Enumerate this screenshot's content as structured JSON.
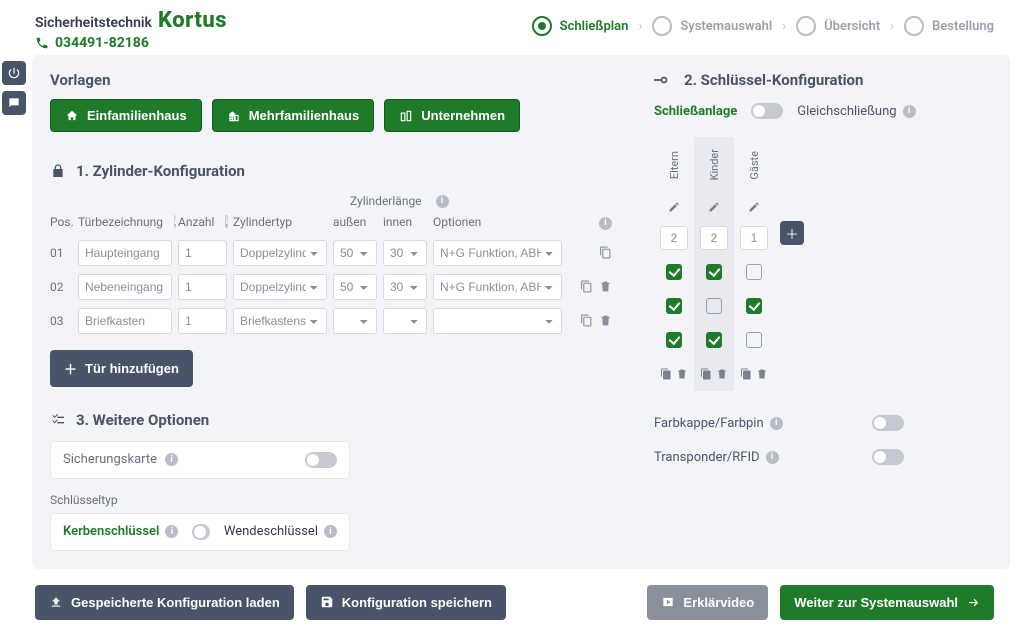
{
  "brand": {
    "sub": "Sicherheitstechnik",
    "main": "Kortus",
    "phone": "034491-82186"
  },
  "steps": [
    {
      "label": "Schließplan",
      "active": true
    },
    {
      "label": "Systemauswahl",
      "active": false
    },
    {
      "label": "Übersicht",
      "active": false
    },
    {
      "label": "Bestellung",
      "active": false
    }
  ],
  "templates": {
    "title": "Vorlagen",
    "items": [
      "Einfamilienhaus",
      "Mehrfamilienhaus",
      "Unternehmen"
    ]
  },
  "section1": {
    "title": "1. Zylinder-Konfiguration"
  },
  "tableHead": {
    "pos": "Pos.",
    "name": "Türbezeichnung",
    "anzahl": "Anzahl",
    "typ": "Zylindertyp",
    "lenGroup": "Zylinderlänge",
    "aussen": "außen",
    "innen": "innen",
    "opt": "Optionen"
  },
  "rows": [
    {
      "pos": "01",
      "name": "Haupteingang",
      "anzahl": "1",
      "typ": "Doppelzylinder",
      "aussen": "50",
      "innen": "30",
      "opt": "N+G Funktion, ABH Kl.II",
      "trash": false
    },
    {
      "pos": "02",
      "name": "Nebeneingang",
      "anzahl": "1",
      "typ": "Doppelzylinder",
      "aussen": "50",
      "innen": "30",
      "opt": "N+G Funktion, ABH Kl.II",
      "trash": true
    },
    {
      "pos": "03",
      "name": "Briefkasten",
      "anzahl": "1",
      "typ": "Briefkastensch…",
      "aussen": "",
      "innen": "",
      "opt": "",
      "trash": true
    }
  ],
  "addDoor": "Tür hinzufügen",
  "section3": {
    "title": "3. Weitere Optionen",
    "sicherung": "Sicherungskarte",
    "keyTypeLabel": "Schlüsseltyp",
    "kerben": "Kerbenschlüssel",
    "wende": "Wendeschlüssel"
  },
  "section2": {
    "title": "2. Schlüssel-Konfiguration",
    "on": "Schließanlage",
    "off": "Gleichschließung"
  },
  "keyCols": [
    {
      "name": "Eltern",
      "qty": "2"
    },
    {
      "name": "Kinder",
      "qty": "2"
    },
    {
      "name": "Gäste",
      "qty": "1"
    }
  ],
  "keyMatrix": [
    [
      true,
      true,
      false
    ],
    [
      true,
      false,
      true
    ],
    [
      true,
      true,
      false
    ]
  ],
  "rightOpts": {
    "farbkappe": "Farbkappe/Farbpin",
    "transponder": "Transponder/RFID"
  },
  "footer": {
    "load": "Gespeicherte Konfiguration laden",
    "save": "Konfiguration speichern",
    "video": "Erklärvideo",
    "next": "Weiter zur Systemauswahl"
  }
}
